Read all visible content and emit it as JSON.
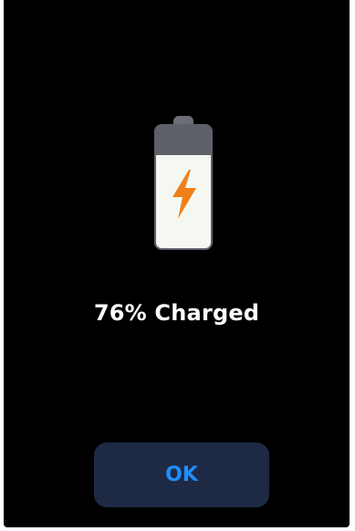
{
  "battery": {
    "charge_fraction": 0.76,
    "icon": "lightning-bolt-icon",
    "bolt_color": "#f0801a",
    "fill_color": "#f4f8f1",
    "empty_color": "#5e616a"
  },
  "status": {
    "text": "76% Charged"
  },
  "dialog": {
    "ok_label": "OK",
    "ok_text_color": "#1e8fff",
    "ok_bg_color": "#1e2a44"
  }
}
